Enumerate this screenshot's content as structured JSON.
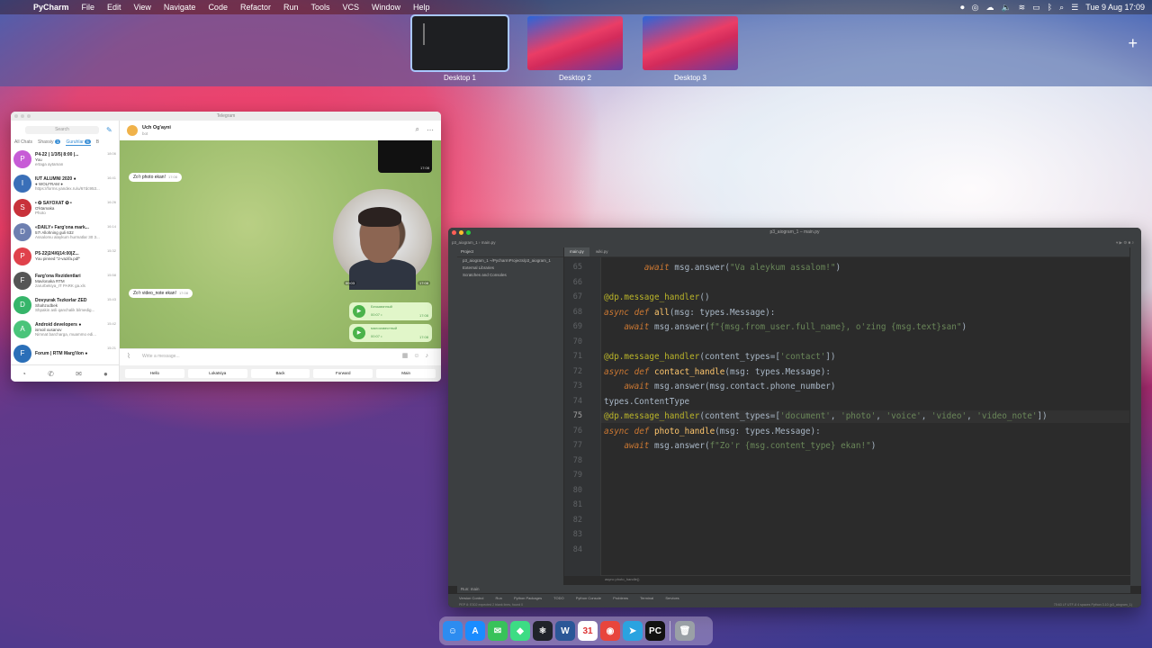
{
  "menubar": {
    "app_name": "PyCharm",
    "items": [
      "File",
      "Edit",
      "View",
      "Navigate",
      "Code",
      "Refactor",
      "Run",
      "Tools",
      "VCS",
      "Window",
      "Help"
    ],
    "clock": "Tue 9 Aug  17:09"
  },
  "mission_control": {
    "desktops": [
      {
        "label": "Desktop 1",
        "selected": true
      },
      {
        "label": "Desktop 2",
        "selected": false
      },
      {
        "label": "Desktop 3",
        "selected": false
      }
    ],
    "add_label": "+"
  },
  "telegram": {
    "window_title": "Telegram",
    "search_placeholder": "Search",
    "folders": [
      "All Chats",
      "Shaxsiy",
      "Guruhlar",
      "B"
    ],
    "folder_badges": {
      "Shaxsiy": "1",
      "Guruhlar": "5"
    },
    "chats": [
      {
        "initial": "P",
        "color": "#c75bd6",
        "title": "P4-22 | 1/3/5| 8:00 |...",
        "line1": "You",
        "line2": "ertaga aytaman",
        "time": "18:06"
      },
      {
        "initial": "I",
        "color": "#3a6fb8",
        "title": "IUT ALUMNI 2020 ●",
        "line1": "● WOLFRAM ●",
        "line2": "https://forms.yandex.ru/u/67dc953...",
        "time": "16:41"
      },
      {
        "initial": "S",
        "color": "#c8313a",
        "title": "• ✪ SAYOXAT ✪ •",
        "line1": "O'ktamaka",
        "line2": "Photo",
        "time": "16:26"
      },
      {
        "initial": "D",
        "color": "#6d7fb0",
        "title": "«DAILY» Farg'ona mark...",
        "line1": "57! Allohning guli 632",
        "line2": "Assalomu alaykum hurmatlar 30 3...",
        "time": "16:14"
      },
      {
        "initial": "P",
        "color": "#e0414b",
        "title": "P5-22|2/4/6|14:00|Z...",
        "line1": "You pinned \"2-vazifa.pdf\"",
        "line2": "",
        "time": "15:32"
      },
      {
        "initial": "F",
        "color": "#555555",
        "title": "Farg'ona Rezidentlari",
        "line1": "Mavlonaka RTM",
        "line2": "zarurbekiya_IT PARK ga.xls",
        "time": "15:58"
      },
      {
        "initial": "D",
        "color": "#36b56a",
        "title": "Dovyurak Tezkorlar ZED",
        "line1": "Shahzodbek",
        "line2": "Shpakin asli qanchalik bilmedig...",
        "time": "15:43"
      },
      {
        "initial": "A",
        "color": "#4ac47a",
        "title": "Android developers ●",
        "line1": "ismoil xusanov",
        "line2": "Nimnat barcharga, muammo edi...",
        "time": "15:42"
      },
      {
        "initial": "F",
        "color": "#2b6fb8",
        "title": "Forum | RTM Marg'ilon ●",
        "line1": "",
        "line2": "",
        "time": "15:21"
      }
    ],
    "chat_header": {
      "name": "Uch Og'ayni",
      "status": "bot"
    },
    "messages": [
      {
        "text": "Zo'r photo ekan!",
        "time": "17:08"
      },
      {
        "text": "Zo'r video_note ekan!",
        "time": "17:08"
      }
    ],
    "video_time": "17:08",
    "video_note_duration": "00:03",
    "video_note_time": "17:08",
    "voices": [
      {
        "title": "Безымянный",
        "duration": "00:07 •",
        "time": "17:08"
      },
      {
        "title": "малоизвестный",
        "duration": "00:07 •",
        "time": "17:08"
      }
    ],
    "input_placeholder": "Write a message...",
    "keyboard": [
      "Hello",
      "Lokatsiya",
      "Back",
      "Forward",
      "Main"
    ]
  },
  "pycharm": {
    "window_title": "p3_aiogram_1 – main.py",
    "breadcrumb": [
      "p3_aiogram_1",
      "main.py"
    ],
    "project_header": "Project",
    "tree": [
      "p3_aiogram_1  ~/PycharmProjects/p3_aiogram_1",
      "External Libraries",
      "Scratches and Consoles"
    ],
    "tabs": [
      {
        "label": "main.py",
        "active": true
      },
      {
        "label": "wiki.py",
        "active": false
      }
    ],
    "lines": [
      {
        "n": "65",
        "code": "        await msg.answer(\"Va aleykum assalom!\")"
      },
      {
        "n": "66",
        "code": ""
      },
      {
        "n": "67",
        "code": "@dp.message_handler()"
      },
      {
        "n": "68",
        "code": "async def all(msg: types.Message):"
      },
      {
        "n": "69",
        "code": "    await msg.answer(f\"{msg.from_user.full_name}, o'zing {msg.text}san\")"
      },
      {
        "n": "70",
        "code": ""
      },
      {
        "n": "71",
        "code": "@dp.message_handler(content_types=['contact'])"
      },
      {
        "n": "72",
        "code": "async def contact_handle(msg: types.Message):"
      },
      {
        "n": "73",
        "code": "    await msg.answer(msg.contact.phone_number)"
      },
      {
        "n": "74",
        "code": "types.ContentType"
      },
      {
        "n": "75",
        "code": "@dp.message_handler(content_types=['document', 'photo', 'voice', 'video', 'video_note'])"
      },
      {
        "n": "76",
        "code": "async def photo_handle(msg: types.Message):"
      },
      {
        "n": "77",
        "code": "    await msg.answer(f\"Zo'r {msg.content_type} ekan!\")"
      },
      {
        "n": "78",
        "code": ""
      },
      {
        "n": "79",
        "code": ""
      },
      {
        "n": "80",
        "code": ""
      },
      {
        "n": "81",
        "code": ""
      },
      {
        "n": "82",
        "code": ""
      },
      {
        "n": "83",
        "code": ""
      },
      {
        "n": "84",
        "code": ""
      }
    ],
    "current_line": "75",
    "crumb_bottom": "async photo_handle()",
    "run_label": "Run:",
    "run_config": "main",
    "tool_windows": [
      "Version Control",
      "Run",
      "Python Packages",
      "TODO",
      "Python Console",
      "Problems",
      "Terminal",
      "Services"
    ],
    "status_left": "PEP 8: E302 expected 2 blank lines, found 0",
    "status_right": "75:63   LF   UTF-8   4 spaces   Python 3.10 (p3_aiogram_1)"
  },
  "dock": {
    "apps": [
      {
        "name": "finder",
        "glyph": "☺",
        "color": "#2d8cf0"
      },
      {
        "name": "app-store",
        "glyph": "A",
        "color": "#1a8cff"
      },
      {
        "name": "messages",
        "glyph": "✉",
        "color": "#38c25a"
      },
      {
        "name": "android-studio",
        "glyph": "◆",
        "color": "#3ddc84"
      },
      {
        "name": "react",
        "glyph": "⚛",
        "color": "#20232a"
      },
      {
        "name": "word",
        "glyph": "W",
        "color": "#2b5797"
      },
      {
        "name": "calendar",
        "glyph": "31",
        "color": "#ffffff"
      },
      {
        "name": "chrome",
        "glyph": "◉",
        "color": "#e8453c"
      },
      {
        "name": "telegram",
        "glyph": "➤",
        "color": "#2aa3e0"
      },
      {
        "name": "pycharm",
        "glyph": "PC",
        "color": "#111111"
      },
      {
        "name": "trash",
        "glyph": "🗑",
        "color": "#9aa0a6"
      }
    ]
  }
}
